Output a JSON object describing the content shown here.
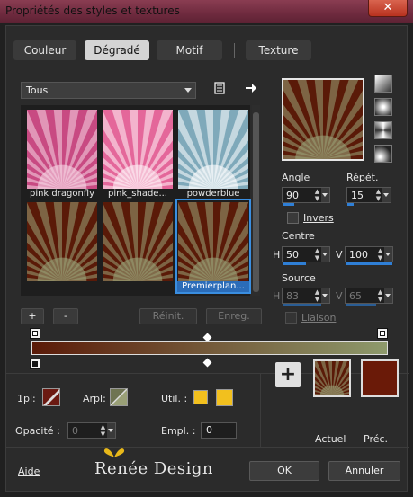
{
  "window": {
    "title": "Propriétés des styles et textures",
    "close_glyph": "✕"
  },
  "tabs": [
    "Couleur",
    "Dégradé",
    "Motif",
    "Texture"
  ],
  "category": {
    "selected": "Tous"
  },
  "gallery": [
    {
      "caption": "pink dragonfly",
      "style": "pink-dragonfly"
    },
    {
      "caption": "pink_shade...",
      "style": "pink-shade"
    },
    {
      "caption": "powderblue",
      "style": "powderblue"
    },
    {
      "caption": "",
      "style": "brown-olive"
    },
    {
      "caption": "",
      "style": "brown-olive"
    },
    {
      "caption": "Premierplan...",
      "style": "brown-olive",
      "selected": true
    }
  ],
  "list_buttons": {
    "add": "+",
    "remove": "-",
    "reset": "Réinit.",
    "save": "Enreg."
  },
  "settings": {
    "angle_label": "Angle",
    "angle": "90",
    "angle_level": 0.25,
    "repeat_label": "Répét.",
    "repeat": "15",
    "repeat_level": 0.15,
    "invert_label": "Invers",
    "invert_checked": false,
    "center_label": "Centre",
    "center_h_label": "H",
    "center_h": "50",
    "center_h_level": 0.5,
    "center_v_label": "V",
    "center_v": "100",
    "center_v_level": 1.0,
    "source_label": "Source",
    "source_h_label": "H",
    "source_h": "83",
    "source_h_level": 0.83,
    "source_v_label": "V",
    "source_v": "65",
    "source_v_level": 0.65,
    "link_label": "Liaison",
    "link_checked": false
  },
  "gradient": {
    "start_color": "#5a1a08",
    "end_color": "#8e9a6c"
  },
  "bottom": {
    "fg_label": "1pl:",
    "bg_label": "Arpl:",
    "util_label": "Util. :",
    "opacity_label": "Opacité :",
    "opacity_value": "0",
    "location_label": "Empl. :",
    "location_value": "0",
    "current_label": "Actuel",
    "previous_label": "Préc.",
    "fg_color": "#6b1a12",
    "util_color": "#f2c01e",
    "previous_color": "#6a1a08",
    "add_glyph": "+"
  },
  "footer": {
    "help": "Aide",
    "brand": "Renée Design",
    "ok": "OK",
    "cancel": "Annuler"
  },
  "icons": [
    "close-icon",
    "list-view-icon",
    "arrow-right-icon",
    "linear-gradient-icon",
    "rectangular-gradient-icon",
    "sunburst-gradient-icon",
    "radial-gradient-icon",
    "spin-arrows-icon",
    "plus-icon"
  ]
}
